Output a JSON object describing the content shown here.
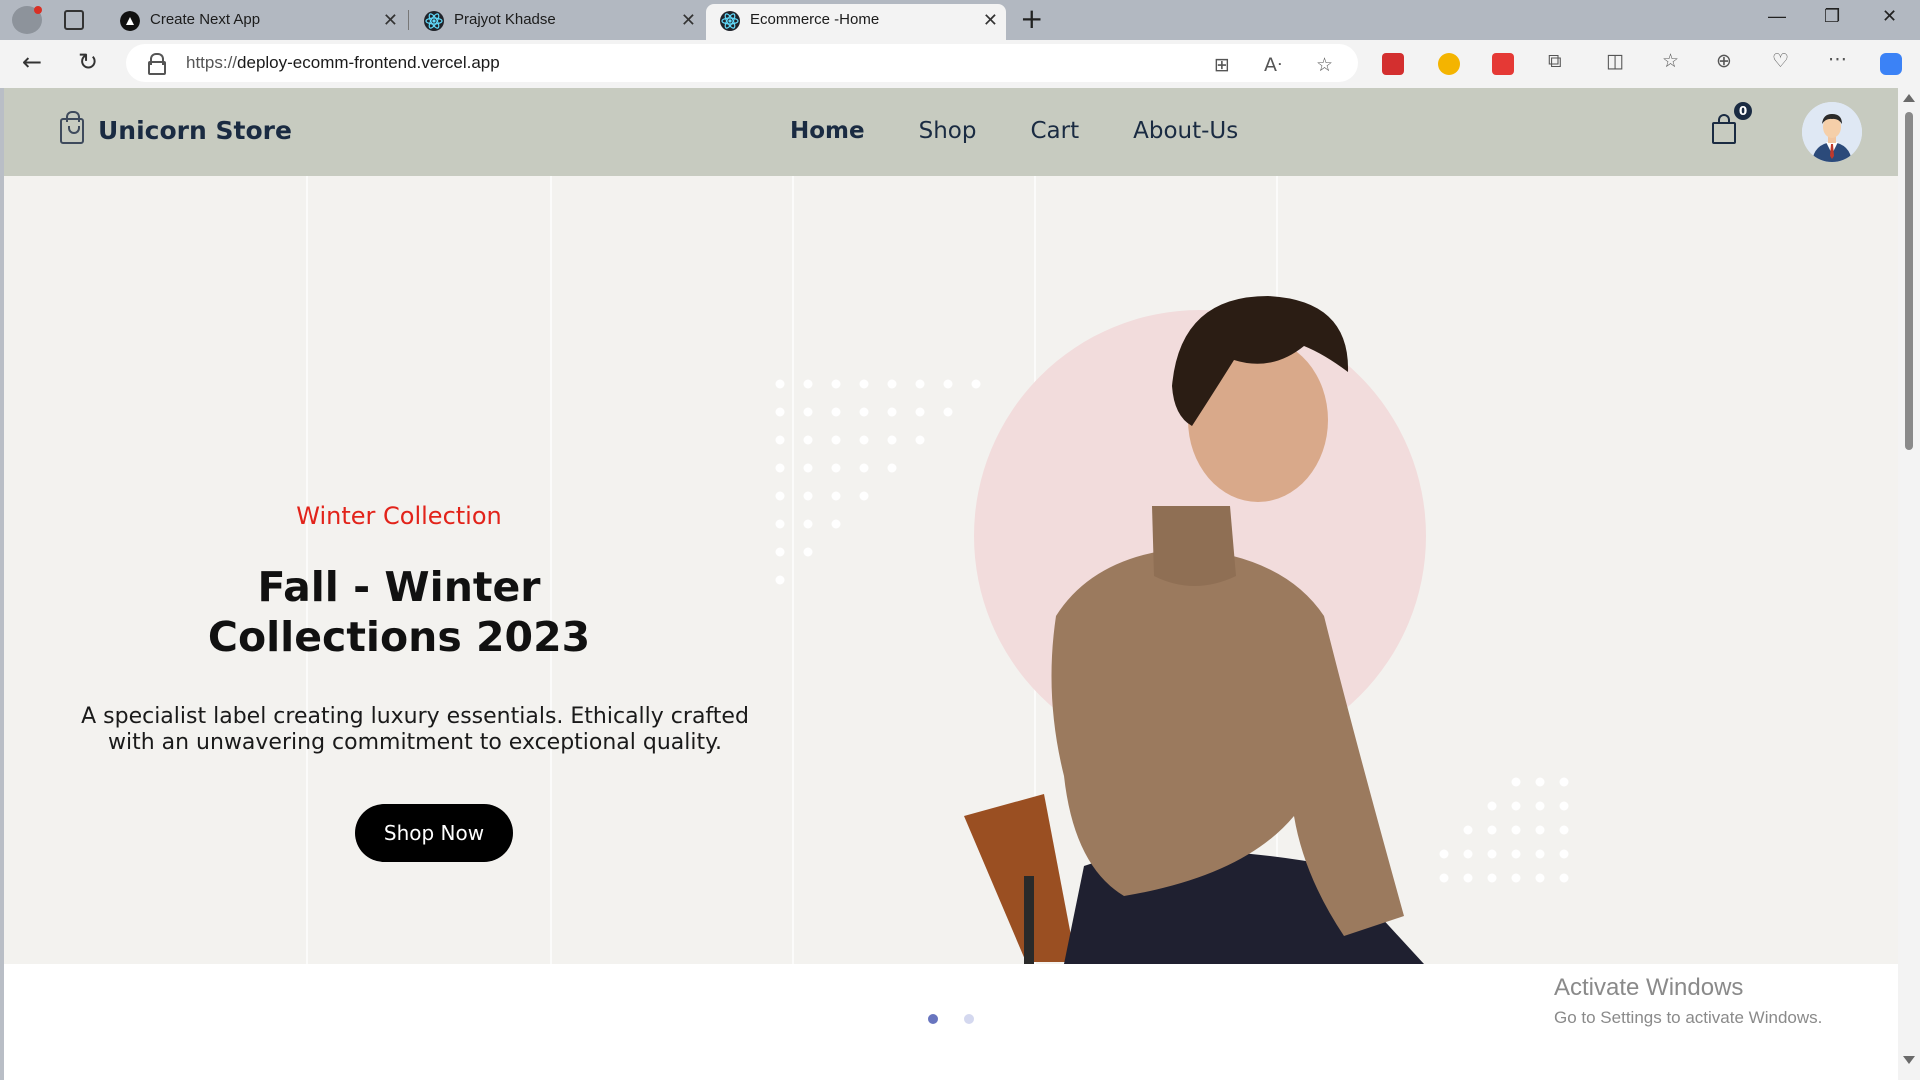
{
  "browser": {
    "tabs": [
      {
        "title": "Create Next App",
        "favicon": "nextjs-icon"
      },
      {
        "title": "Prajyot Khadse",
        "favicon": "react-icon"
      },
      {
        "title": "Ecommerce -Home",
        "favicon": "react-icon",
        "active": true
      }
    ],
    "new_tab_label": "+",
    "url_prefix": "https://",
    "url_host": "deploy-ecomm-frontend.vercel.app",
    "window_controls": {
      "minimize": "—",
      "restore": "❐",
      "close": "✕"
    }
  },
  "header": {
    "brand": "Unicorn Store",
    "nav": [
      "Home",
      "Shop",
      "Cart",
      "About-Us"
    ],
    "active_nav": "Home",
    "cart_count": "0"
  },
  "hero": {
    "eyebrow": "Winter Collection",
    "headline_line1": "Fall - Winter",
    "headline_line2": "Collections 2023",
    "subcopy_line1": "A specialist label creating luxury essentials. Ethically crafted",
    "subcopy_line2": "with an unwavering commitment to exceptional quality.",
    "cta": "Shop Now"
  },
  "slider": {
    "slides": 2,
    "active_slide": 1
  },
  "watermark": {
    "title": "Activate Windows",
    "subtitle": "Go to Settings to activate Windows."
  },
  "colors": {
    "header_bg": "#c7cbc0",
    "hero_bg": "#f3f2ef",
    "eyebrow": "#e2231a",
    "cta_bg": "#000000",
    "dot_active": "#6875bf",
    "dot_inactive": "#d4d8ef"
  }
}
